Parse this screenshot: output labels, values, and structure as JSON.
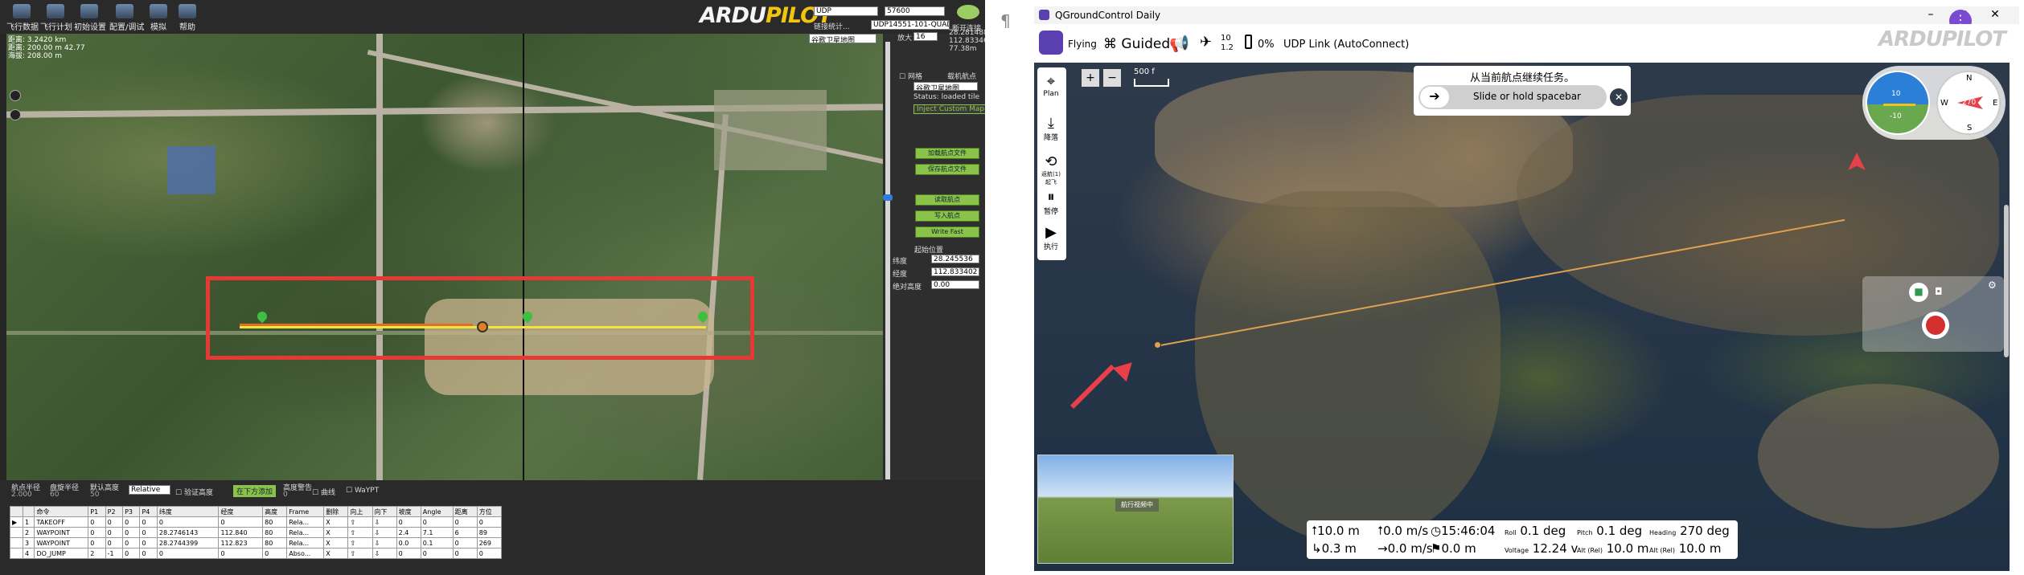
{
  "left_app": {
    "menu": [
      {
        "label": "飞行数据"
      },
      {
        "label": "飞行计划"
      },
      {
        "label": "初始设置"
      },
      {
        "label": "配置/调试"
      },
      {
        "label": "模拟"
      },
      {
        "label": "帮助"
      }
    ],
    "logo": {
      "part1": "ARDU",
      "part2": "PILOT"
    },
    "header_fields": {
      "udp": "UDP",
      "baud": "57600",
      "link_label": "链接统计...",
      "connection": "UDP14551-101-QUADR",
      "connect_label": "断开连接"
    },
    "coords_text": [
      "距离: 3.2420 km",
      "距离: 200.00 m 42.77",
      "海拔: 208.00 m"
    ],
    "map_dropdown": "谷歌卫星地图",
    "right_panel": {
      "checkbox1": "网格",
      "checkbox2": "载机航点",
      "map_select": "谷歌卫星地图",
      "status": "Status: loaded tile",
      "zoom_label": "放大",
      "zoom_value": "16",
      "lat_top": "28.2814881",
      "lon_top": "112.833462",
      "alt_top": "77.38m",
      "buttons": [
        "Inject Custom Map",
        "加载航点文件",
        "保存航点文件",
        "读取航点",
        "写入航点",
        "Write Fast"
      ],
      "home_title": "起始位置",
      "home_lat_label": "纬度",
      "home_lat": "28.245536",
      "home_lon_label": "经度",
      "home_lon": "112.833402",
      "home_alt_label": "绝对高度",
      "home_alt": "0.00"
    },
    "bottom_bar": {
      "wp_radius_label": "航点半径",
      "wp_radius": "2.000",
      "loiter_radius_label": "盘旋半径",
      "loiter_radius": "60",
      "default_alt_label": "默认高度",
      "default_alt": "50",
      "alt_mode": "Relative",
      "verify_alt": "验证高度",
      "add_below": "在下方添加",
      "alt_warning_label": "高度警告",
      "alt_warning": "0",
      "spline": "曲线",
      "splinefit": "WaYPT"
    },
    "table": {
      "headers": [
        "",
        "",
        "命令",
        "P1",
        "P2",
        "P3",
        "P4",
        "纬度",
        "经度",
        "高度",
        "Frame",
        "删除",
        "向上",
        "向下",
        "坡度",
        "Angle",
        "距离",
        "方位"
      ],
      "rows": [
        [
          "▶",
          "1",
          "TAKEOFF",
          "0",
          "0",
          "0",
          "0",
          "0",
          "0",
          "80",
          "Rela...",
          "X",
          "⇧",
          "⇩",
          "0",
          "0",
          "0",
          "0"
        ],
        [
          "",
          "2",
          "WAYPOINT",
          "0",
          "0",
          "0",
          "0",
          "28.2746143",
          "112.840",
          "80",
          "Rela...",
          "X",
          "⇧",
          "⇩",
          "2.4",
          "7.1",
          "6",
          "89"
        ],
        [
          "",
          "3",
          "WAYPOINT",
          "0",
          "0",
          "0",
          "0",
          "28.2744399",
          "112.823",
          "80",
          "Rela...",
          "X",
          "⇧",
          "⇩",
          "0.0",
          "0.1",
          "0",
          "269"
        ],
        [
          "",
          "4",
          "DO_JUMP",
          "2",
          "-1",
          "0",
          "0",
          "0",
          "0",
          "0",
          "Abso...",
          "X",
          "⇧",
          "⇩",
          "0",
          "0",
          "0",
          "0"
        ]
      ]
    }
  },
  "divider_mark": "¶",
  "right_app": {
    "window_title": "QGroundControl Daily",
    "toolbar": {
      "status": "Flying",
      "mode": "Guided",
      "sat_count": "10",
      "hdop": "1.2",
      "battery": "0%",
      "link": "UDP Link (AutoConnect)"
    },
    "logo": "ARDUPILOT",
    "left_tools": [
      {
        "label": "Plan",
        "icon": "plan-icon"
      },
      {
        "label": "降落",
        "icon": "land-icon"
      },
      {
        "label": "返航(1)起飞",
        "icon": "rtl-icon"
      },
      {
        "label": "暂停",
        "icon": "pause-icon"
      },
      {
        "label": "执行",
        "icon": "play-icon"
      }
    ],
    "scale_value": "500",
    "scale_unit": "f",
    "guided_prompt": {
      "title": "从当前航点继续任务。",
      "slider_text": "Slide or hold spacebar"
    },
    "video_preview_label": "航行视频中",
    "compass": {
      "n": "N",
      "e": "E",
      "s": "S",
      "w": "W",
      "heading": "270"
    },
    "attitude": {
      "top": "10",
      "bottom": "-10"
    },
    "telemetry": {
      "alt": "10.0 m",
      "vspeed": "0.0 m/s",
      "time": "15:46:04",
      "roll_label": "Roll",
      "roll": "0.1 deg",
      "pitch_label": "Pitch",
      "pitch": "0.1 deg",
      "heading_label": "Heading",
      "heading": "270 deg",
      "dist": "0.3 m",
      "hspeed": "0.0 m/s",
      "flight_dist": "0.0 m",
      "voltage_label": "Voltage",
      "voltage": "12.24 v",
      "alt_rel_label": "Alt (Rel)",
      "alt_rel": "10.0 m",
      "alt_rel2_label": "Alt (Rel)",
      "alt_rel2": "10.0 m"
    },
    "colors": {
      "accent": "#5a3fb0",
      "route": "#e0a050",
      "arrow": "#e8404a",
      "record": "#d32f2f"
    }
  }
}
